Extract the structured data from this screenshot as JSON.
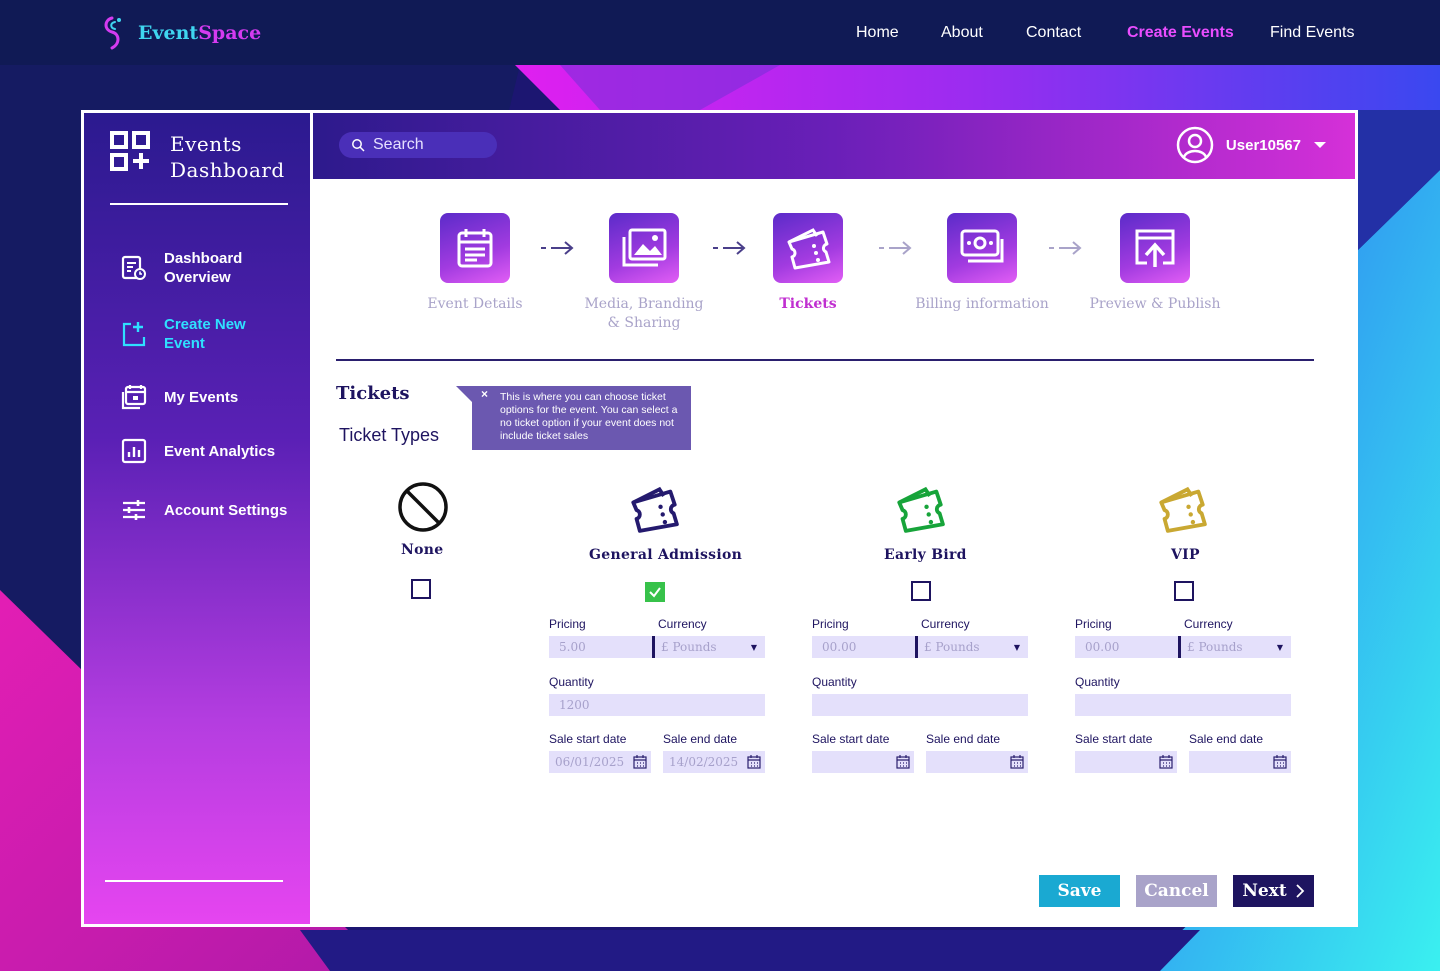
{
  "brand": {
    "name_part1": "Event",
    "name_part2": "Space"
  },
  "nav": [
    "Home",
    "About",
    "Contact",
    "Create Events",
    "Find Events"
  ],
  "nav_active": "Create Events",
  "sidebar": {
    "title_line1": "Events",
    "title_line2": "Dashboard",
    "items": [
      {
        "label1": "Dashboard",
        "label2": "Overview",
        "icon": "dashboard-overview-icon"
      },
      {
        "label1": "Create New",
        "label2": "Event",
        "icon": "create-event-icon"
      },
      {
        "label1": "My Events",
        "label2": "",
        "icon": "calendar-icon"
      },
      {
        "label1": "Event Analytics",
        "label2": "",
        "icon": "analytics-icon"
      },
      {
        "label1": "Account Settings",
        "label2": "",
        "icon": "settings-sliders-icon"
      }
    ],
    "active_item": "Create New Event"
  },
  "search": {
    "placeholder": "Search"
  },
  "user": {
    "name": "User10567"
  },
  "steps": [
    {
      "line1": "Event Details",
      "line2": "",
      "icon": "calendar-form-icon"
    },
    {
      "line1": "Media, Branding",
      "line2": "& Sharing",
      "icon": "images-icon"
    },
    {
      "line1": "Tickets",
      "line2": "",
      "icon": "ticket-icon"
    },
    {
      "line1": "Billing information",
      "line2": "",
      "icon": "cash-icon"
    },
    {
      "line1": "Preview & Publish",
      "line2": "",
      "icon": "upload-icon"
    }
  ],
  "active_step": "Tickets",
  "section": {
    "title": "Tickets",
    "subtitle": "Ticket Types"
  },
  "tooltip": {
    "close": "×",
    "text": "This is where you can choose ticket options for the event. You can select a no ticket option if your event does not include ticket sales"
  },
  "ticket_none": {
    "label": "None",
    "checked": false
  },
  "tickets": [
    {
      "name": "General Admission",
      "color": "#241a6e",
      "checked": true,
      "pricing_label": "Pricing",
      "pricing": "5.00",
      "currency_label": "Currency",
      "currency": "£ Pounds",
      "quantity_label": "Quantity",
      "quantity": "1200",
      "start_label": "Sale start date",
      "start": "06/01/2025",
      "end_label": "Sale end date",
      "end": "14/02/2025"
    },
    {
      "name": "Early Bird",
      "color": "#17a43a",
      "checked": false,
      "pricing_label": "Pricing",
      "pricing": "00.00",
      "currency_label": "Currency",
      "currency": "£ Pounds",
      "quantity_label": "Quantity",
      "quantity": "",
      "start_label": "Sale start date",
      "start": "",
      "end_label": "Sale end date",
      "end": ""
    },
    {
      "name": "VIP",
      "color": "#c9a832",
      "checked": false,
      "pricing_label": "Pricing",
      "pricing": "00.00",
      "currency_label": "Currency",
      "currency": "£ Pounds",
      "quantity_label": "Quantity",
      "quantity": "",
      "start_label": "Sale start date",
      "start": "",
      "end_label": "Sale end date",
      "end": ""
    }
  ],
  "buttons": {
    "save": "Save",
    "cancel": "Cancel",
    "next": "Next"
  },
  "colors": {
    "accent_cyan": "#1aa9d2",
    "accent_purple": "#e94dff",
    "navy": "#1e1460",
    "cancel": "#a9a3c9"
  }
}
